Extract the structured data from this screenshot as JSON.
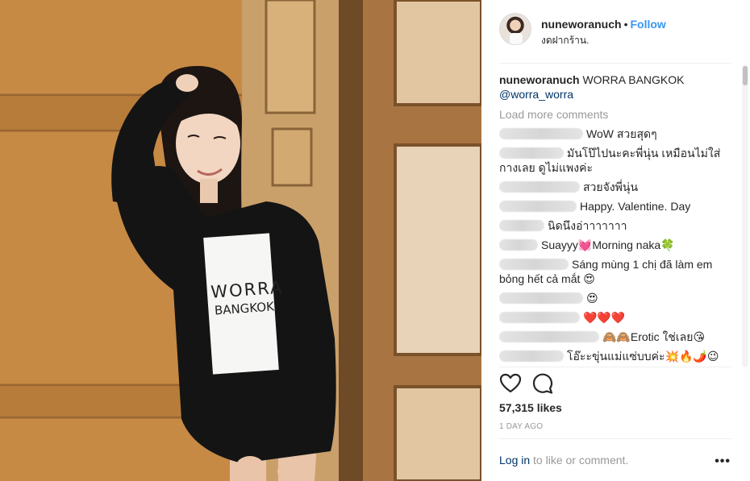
{
  "header": {
    "username": "nuneworanuch",
    "separator": "•",
    "follow_label": "Follow",
    "location": "งดฝากร้าน."
  },
  "caption": {
    "username": "nuneworanuch",
    "text": "WORRA BANGKOK",
    "mention": "@worra_worra"
  },
  "load_more_label": "Load more comments",
  "comments": [
    {
      "text": "WoW สวยสุดๆ"
    },
    {
      "text": "มันโป๊ไปนะคะพี่นุ่น เหมือนไม่ใส่กางเลย ดูไม่แพงค่ะ"
    },
    {
      "text": "สวยจังพี่นุ่น"
    },
    {
      "text": "Happy. Valentine. Day"
    },
    {
      "text": "นิดนึงอ่าาาาาาา"
    },
    {
      "text": "Suayyy💓Morning naka🍀"
    },
    {
      "text": "Sáng mùng 1 chị đã làm em bỏng hết cả mắt 😍"
    },
    {
      "text": "😍"
    },
    {
      "text": "❤️❤️❤️"
    },
    {
      "text": "🙈🙈Erotic ใช่เลย😘"
    },
    {
      "text": "โอ๊ะะขุ่นแม่แซ่บบค่ะ💥🔥🌶️😉"
    }
  ],
  "stats": {
    "likes": "57,315 likes",
    "time_ago": "1 DAY AGO"
  },
  "footer": {
    "login_link": "Log in",
    "login_rest": " to like or comment.",
    "more_label": "•••"
  },
  "photo": {
    "shirt_text_line1": "WORRA",
    "shirt_text_line2": "BANGKOK"
  },
  "icons": {
    "like": "heart-icon",
    "comment": "comment-bubble-icon",
    "more": "ellipsis-icon"
  },
  "colors": {
    "link_blue": "#3897f0",
    "mention": "#003569",
    "muted": "#999999"
  }
}
